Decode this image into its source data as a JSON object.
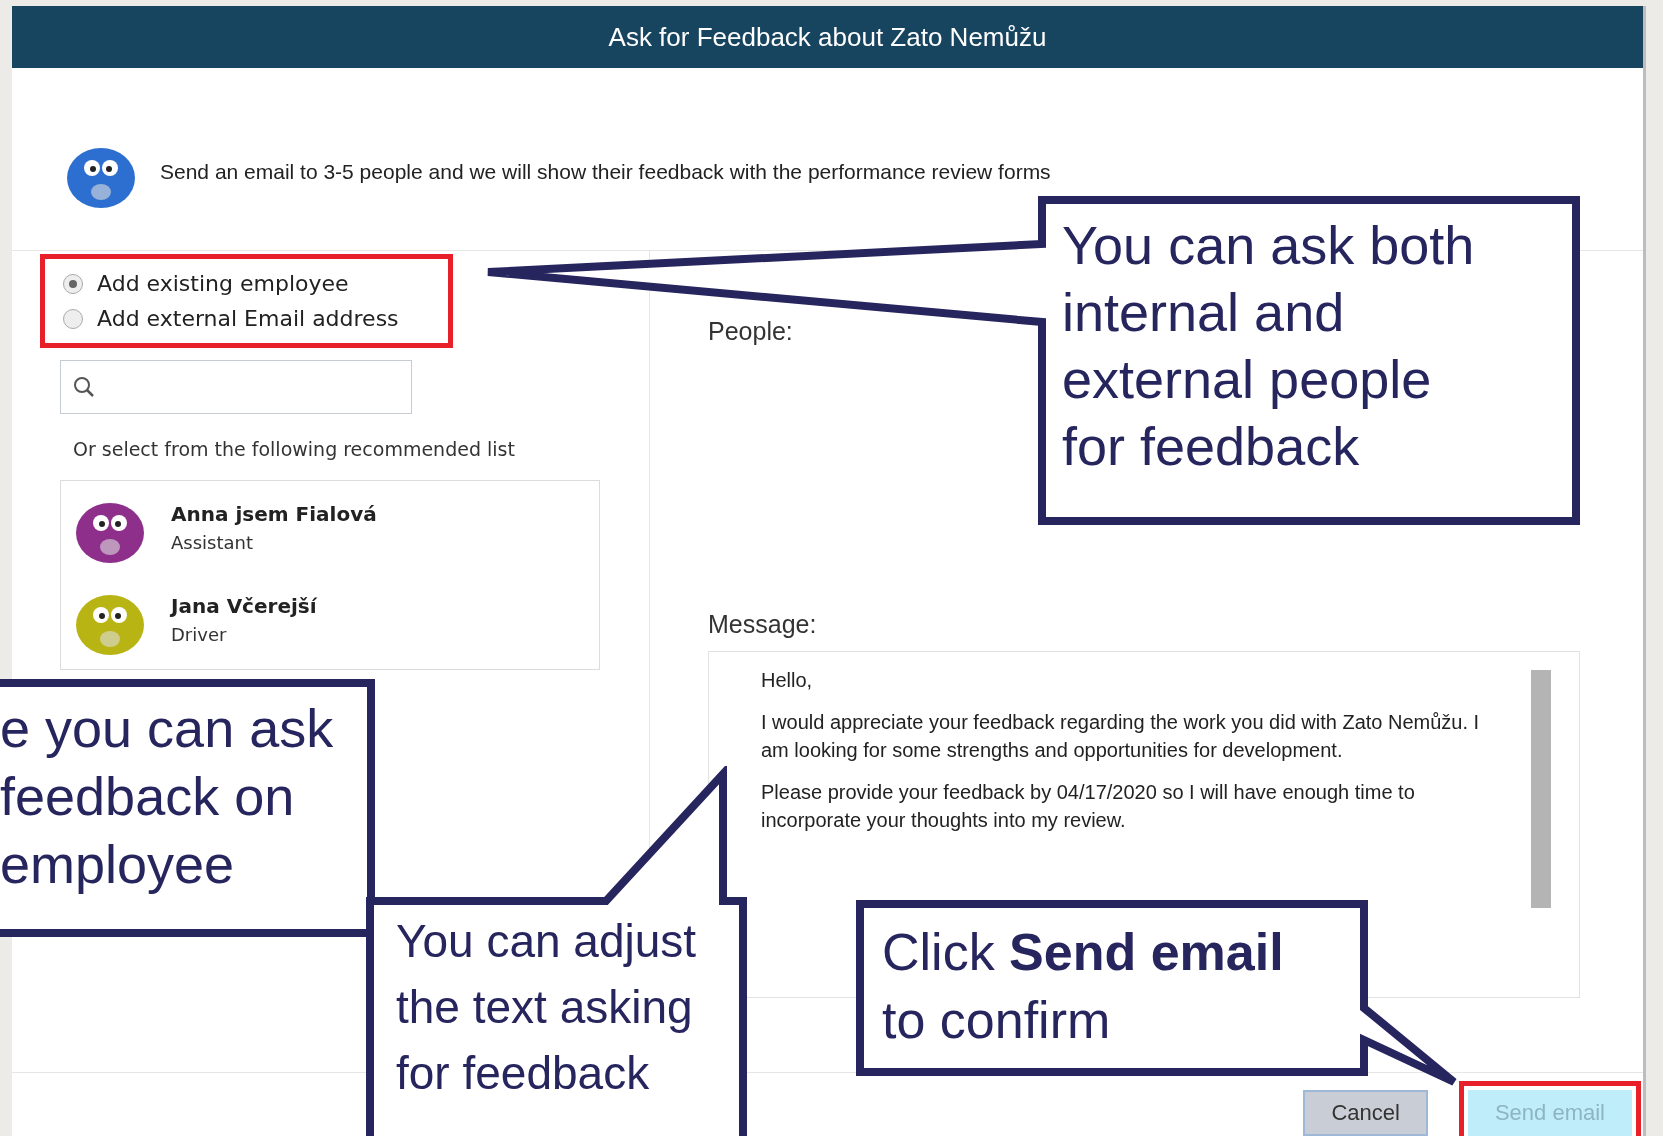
{
  "dialog": {
    "title": "Ask for Feedback about Zato Nemůžu",
    "intro": "Send an email to 3-5 people and we will show their feedback with the performance review forms",
    "radio_group": {
      "highlighted": true,
      "options": [
        {
          "label": "Add existing employee",
          "selected": true
        },
        {
          "label": "Add external Email address",
          "selected": false
        }
      ]
    },
    "recommended_label": "Or select from the following recommended list",
    "people": [
      {
        "name": "Anna jsem Fialová",
        "role": "Assistant"
      },
      {
        "name": "Jana Včerejší",
        "role": "Driver"
      }
    ],
    "people_label": "People:",
    "message_label": "Message:",
    "message": [
      "Hello,",
      "I would appreciate your feedback regarding the work you did with Zato Nemůžu.  I am looking for some strengths and opportunities for development.",
      "Please provide your feedback by 04/17/2020 so I will have enough time to incorporate your thoughts into my review."
    ],
    "buttons": [
      {
        "label": "Cancel",
        "kind": "secondary",
        "highlighted": false
      },
      {
        "label": "Send email",
        "kind": "primary",
        "highlighted": true
      }
    ]
  },
  "callouts": [
    {
      "lines": [
        "You can ask both",
        "internal and",
        "external people",
        "for feedback"
      ]
    },
    {
      "lines": [
        "e you can ask",
        "feedback on",
        "employee"
      ]
    },
    {
      "lines": [
        "You can adjust",
        "the text asking",
        "for feedback"
      ]
    },
    {
      "lines": [
        "Click **Send email**",
        "to confirm"
      ]
    }
  ]
}
